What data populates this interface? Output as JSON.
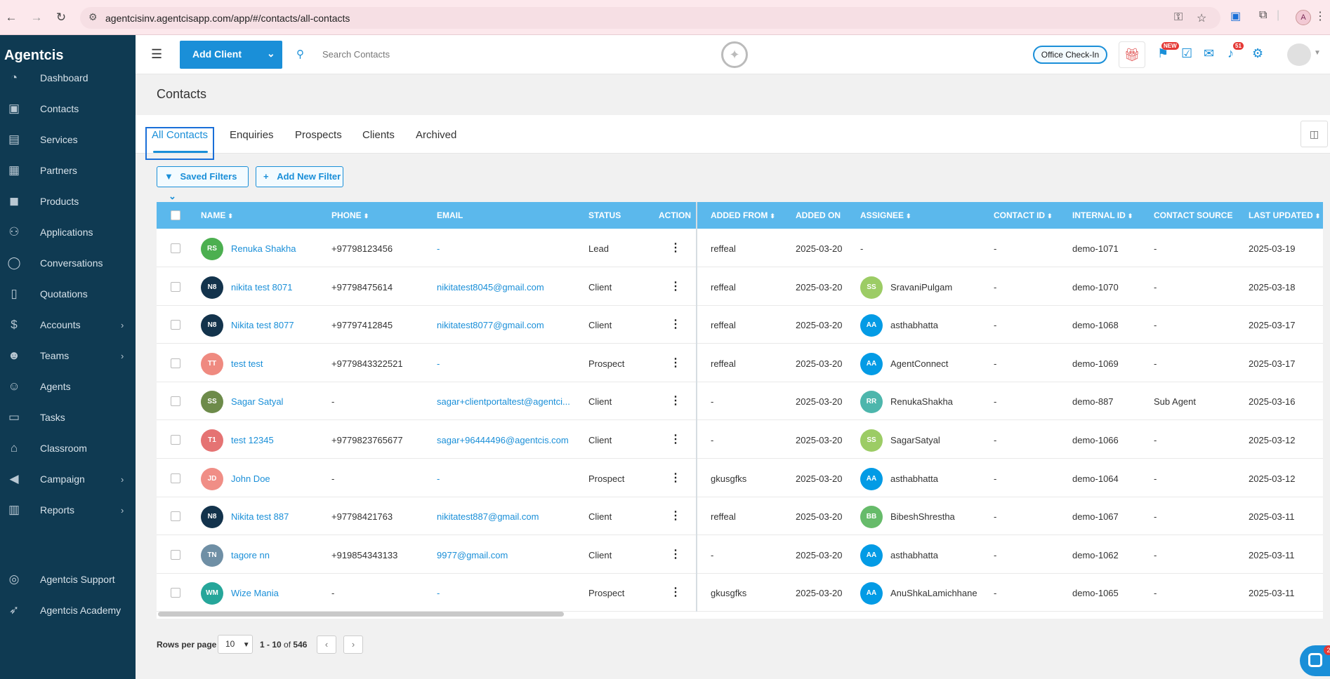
{
  "browser": {
    "url": "agentcisinv.agentcisapp.com/app/#/contacts/all-contacts",
    "profile_initial": "A"
  },
  "sidebar": {
    "brand": "Agentcis",
    "items": [
      {
        "label": "Dashboard",
        "icon": "gauge-icon",
        "glyph": "◔",
        "chev": ""
      },
      {
        "label": "Contacts",
        "icon": "contacts-icon",
        "glyph": "▣",
        "chev": ""
      },
      {
        "label": "Services",
        "icon": "services-icon",
        "glyph": "▤",
        "chev": ""
      },
      {
        "label": "Partners",
        "icon": "building-icon",
        "glyph": "▦",
        "chev": ""
      },
      {
        "label": "Products",
        "icon": "products-icon",
        "glyph": "◼",
        "chev": ""
      },
      {
        "label": "Applications",
        "icon": "applications-icon",
        "glyph": "⚇",
        "chev": ""
      },
      {
        "label": "Conversations",
        "icon": "chat-icon",
        "glyph": "◯",
        "chev": ""
      },
      {
        "label": "Quotations",
        "icon": "document-icon",
        "glyph": "▯",
        "chev": ""
      },
      {
        "label": "Accounts",
        "icon": "dollar-icon",
        "glyph": "$",
        "chev": "›"
      },
      {
        "label": "Teams",
        "icon": "team-icon",
        "glyph": "☻",
        "chev": "›"
      },
      {
        "label": "Agents",
        "icon": "agents-icon",
        "glyph": "☺",
        "chev": ""
      },
      {
        "label": "Tasks",
        "icon": "briefcase-icon",
        "glyph": "▭",
        "chev": ""
      },
      {
        "label": "Classroom",
        "icon": "classroom-icon",
        "glyph": "⌂",
        "chev": ""
      },
      {
        "label": "Campaign",
        "icon": "megaphone-icon",
        "glyph": "◀",
        "chev": "›"
      },
      {
        "label": "Reports",
        "icon": "clipboard-icon",
        "glyph": "▥",
        "chev": "›"
      }
    ],
    "support": [
      {
        "label": "Agentcis Support",
        "icon": "lifebuoy-icon",
        "glyph": "◎"
      },
      {
        "label": "Agentcis Academy",
        "icon": "rocket-icon",
        "glyph": "➶"
      }
    ]
  },
  "header": {
    "add_client_label": "Add Client",
    "search_placeholder": "Search Contacts",
    "checkin_label": "Office Check-In",
    "badge_new": "NEW",
    "badge_count": "51"
  },
  "page": {
    "title": "Contacts",
    "tabs": [
      "All Contacts",
      "Enquiries",
      "Prospects",
      "Clients",
      "Archived"
    ],
    "saved_filters_label": "Saved Filters",
    "add_filter_label": "Add New Filter"
  },
  "table": {
    "columns": {
      "name": "NAME",
      "phone": "PHONE",
      "email": "EMAIL",
      "status": "STATUS",
      "action": "ACTION",
      "added_from": "ADDED FROM",
      "added_on": "ADDED ON",
      "assignee": "ASSIGNEE",
      "contact_id": "CONTACT ID",
      "internal_id": "INTERNAL ID",
      "contact_source": "CONTACT SOURCE",
      "last_updated": "LAST UPDATED"
    },
    "rows": [
      {
        "initials": "RS",
        "avatar_color": "#4caf50",
        "name": "Renuka Shakha",
        "phone": "+97798123456",
        "email": "-",
        "status": "Lead",
        "added_from": "reffeal",
        "added_on": "2025-03-20",
        "assignee_initials": "",
        "assignee_color": "",
        "assignee": "-",
        "contact_id": "-",
        "internal_id": "demo-1071",
        "contact_source": "-",
        "last_updated": "2025-03-19"
      },
      {
        "initials": "N8",
        "avatar_color": "#13334c",
        "name": "nikita test 8071",
        "phone": "+97798475614",
        "email": "nikitatest8045@gmail.com",
        "status": "Client",
        "added_from": "reffeal",
        "added_on": "2025-03-20",
        "assignee_initials": "SS",
        "assignee_color": "#9ccc65",
        "assignee": "SravaniPulgam",
        "contact_id": "-",
        "internal_id": "demo-1070",
        "contact_source": "-",
        "last_updated": "2025-03-18"
      },
      {
        "initials": "N8",
        "avatar_color": "#13334c",
        "name": "Nikita test 8077",
        "phone": "+97797412845",
        "email": "nikitatest8077@gmail.com",
        "status": "Client",
        "added_from": "reffeal",
        "added_on": "2025-03-20",
        "assignee_initials": "AA",
        "assignee_color": "#039be5",
        "assignee": "asthabhatta",
        "contact_id": "-",
        "internal_id": "demo-1068",
        "contact_source": "-",
        "last_updated": "2025-03-17"
      },
      {
        "initials": "TT",
        "avatar_color": "#ef8a80",
        "name": "test test",
        "phone": "+9779843322521",
        "email": "-",
        "status": "Prospect",
        "added_from": "reffeal",
        "added_on": "2025-03-20",
        "assignee_initials": "AA",
        "assignee_color": "#039be5",
        "assignee": "AgentConnect",
        "contact_id": "-",
        "internal_id": "demo-1069",
        "contact_source": "-",
        "last_updated": "2025-03-17"
      },
      {
        "initials": "SS",
        "avatar_color": "#6d8b4a",
        "name": "Sagar Satyal",
        "phone": "-",
        "email": "sagar+clientportaltest@agentci...",
        "status": "Client",
        "added_from": "-",
        "added_on": "2025-03-20",
        "assignee_initials": "RR",
        "assignee_color": "#4db6ac",
        "assignee": "RenukaShakha",
        "contact_id": "-",
        "internal_id": "demo-887",
        "contact_source": "Sub Agent",
        "last_updated": "2025-03-16"
      },
      {
        "initials": "T1",
        "avatar_color": "#e57373",
        "name": "test 12345",
        "phone": "+9779823765677",
        "email": "sagar+96444496@agentcis.com",
        "status": "Client",
        "added_from": "-",
        "added_on": "2025-03-20",
        "assignee_initials": "SS",
        "assignee_color": "#9ccc65",
        "assignee": "SagarSatyal",
        "contact_id": "-",
        "internal_id": "demo-1066",
        "contact_source": "-",
        "last_updated": "2025-03-12"
      },
      {
        "initials": "JD",
        "avatar_color": "#f08e86",
        "name": "John Doe",
        "phone": "-",
        "email": "-",
        "status": "Prospect",
        "added_from": "gkusgfks",
        "added_on": "2025-03-20",
        "assignee_initials": "AA",
        "assignee_color": "#039be5",
        "assignee": "asthabhatta",
        "contact_id": "-",
        "internal_id": "demo-1064",
        "contact_source": "-",
        "last_updated": "2025-03-12"
      },
      {
        "initials": "N8",
        "avatar_color": "#13334c",
        "name": "Nikita test 887",
        "phone": "+97798421763",
        "email": "nikitatest887@gmail.com",
        "status": "Client",
        "added_from": "reffeal",
        "added_on": "2025-03-20",
        "assignee_initials": "BB",
        "assignee_color": "#66bb6a",
        "assignee": "BibeshShrestha",
        "contact_id": "-",
        "internal_id": "demo-1067",
        "contact_source": "-",
        "last_updated": "2025-03-11"
      },
      {
        "initials": "TN",
        "avatar_color": "#6f8fa5",
        "name": "tagore nn",
        "phone": "+919854343133",
        "email": "9977@gmail.com",
        "status": "Client",
        "added_from": "-",
        "added_on": "2025-03-20",
        "assignee_initials": "AA",
        "assignee_color": "#039be5",
        "assignee": "asthabhatta",
        "contact_id": "-",
        "internal_id": "demo-1062",
        "contact_source": "-",
        "last_updated": "2025-03-11"
      },
      {
        "initials": "WM",
        "avatar_color": "#26a69a",
        "name": "Wize Mania",
        "phone": "-",
        "email": "-",
        "status": "Prospect",
        "added_from": "gkusgfks",
        "added_on": "2025-03-20",
        "assignee_initials": "AA",
        "assignee_color": "#039be5",
        "assignee": "AnuShkaLamichhane",
        "contact_id": "-",
        "internal_id": "demo-1065",
        "contact_source": "-",
        "last_updated": "2025-03-11"
      }
    ]
  },
  "pagination": {
    "rows_per_page_label": "Rows per page",
    "rows_per_page_value": "10",
    "range_start": "1 - 10",
    "range_of": "of",
    "total": "546"
  },
  "chat": {
    "badge": "2"
  }
}
